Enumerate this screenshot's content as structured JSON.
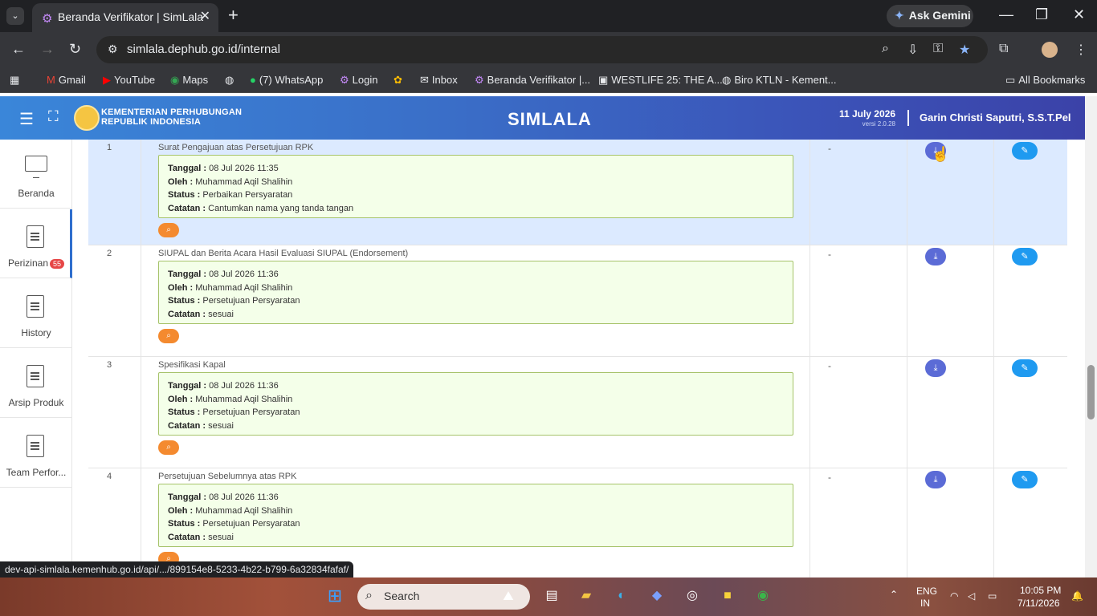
{
  "browser": {
    "tab_title": "Beranda Verifikator | SimLala",
    "url": "simlala.dephub.go.id/internal",
    "ask_gemini": "Ask Gemini",
    "all_bookmarks": "All Bookmarks",
    "bookmarks": [
      {
        "icon": "gmail-icon",
        "label": "Gmail"
      },
      {
        "icon": "youtube-icon",
        "label": "YouTube"
      },
      {
        "icon": "maps-icon",
        "label": "Maps"
      },
      {
        "icon": "globe-icon",
        "label": ""
      },
      {
        "icon": "whatsapp-icon",
        "label": "(7) WhatsApp"
      },
      {
        "icon": "login-icon",
        "label": "Login"
      },
      {
        "icon": "photos-icon",
        "label": ""
      },
      {
        "icon": "inbox-icon",
        "label": "Inbox"
      },
      {
        "icon": "dephub-icon",
        "label": "Beranda Verifikator |..."
      },
      {
        "icon": "letterboxd-icon",
        "label": "WESTLIFE 25: THE A..."
      },
      {
        "icon": "globe-icon",
        "label": "Biro KTLN - Kement..."
      }
    ],
    "status_url": "dev-api-simlala.kemenhub.go.id/api/.../899154e8-5233-4b22-b799-6a32834fafaf/"
  },
  "header": {
    "org_line1": "KEMENTERIAN PERHUBUNGAN",
    "org_line2": "REPUBLIK INDONESIA",
    "app_title": "SIMLALA",
    "date": "11 July 2026",
    "version": "versi 2.0.28",
    "user": "Garin Christi Saputri, S.S.T.Pel"
  },
  "sidebar": {
    "items": [
      {
        "label": "Beranda",
        "icon": "monitor-icon"
      },
      {
        "label": "Perizinan",
        "icon": "document-icon",
        "badge": "55"
      },
      {
        "label": "History",
        "icon": "document-icon"
      },
      {
        "label": "Arsip Produk",
        "icon": "document-icon"
      },
      {
        "label": "Team Perfor...",
        "icon": "document-icon"
      }
    ]
  },
  "labels": {
    "tanggal": "Tanggal :",
    "oleh": "Oleh :",
    "status": "Status :",
    "catatan": "Catatan :"
  },
  "rows": [
    {
      "no": "1",
      "title": "Surat Pengajuan atas Persetujuan RPK",
      "tanggal": "08 Jul 2026 11:35",
      "oleh": "Muhammad Aqil Shalihin",
      "status": "Perbaikan Persyaratan",
      "catatan": "Cantumkan nama yang tanda tangan",
      "extra": "-"
    },
    {
      "no": "2",
      "title": "SIUPAL dan Berita Acara Hasil Evaluasi SIUPAL (Endorsement)",
      "tanggal": "08 Jul 2026 11:36",
      "oleh": "Muhammad Aqil Shalihin",
      "status": "Persetujuan Persyaratan",
      "catatan": "sesuai",
      "extra": "-"
    },
    {
      "no": "3",
      "title": "Spesifikasi Kapal",
      "tanggal": "08 Jul 2026 11:36",
      "oleh": "Muhammad Aqil Shalihin",
      "status": "Persetujuan Persyaratan",
      "catatan": "sesuai",
      "extra": "-"
    },
    {
      "no": "4",
      "title": "Persetujuan Sebelumnya atas RPK",
      "tanggal": "08 Jul 2026 11:36",
      "oleh": "Muhammad Aqil Shalihin",
      "status": "Persetujuan Persyaratan",
      "catatan": "sesuai",
      "extra": "-"
    }
  ],
  "taskbar": {
    "search": "Search",
    "lang1": "ENG",
    "lang2": "IN",
    "time": "10:05 PM",
    "date": "7/11/2026"
  }
}
